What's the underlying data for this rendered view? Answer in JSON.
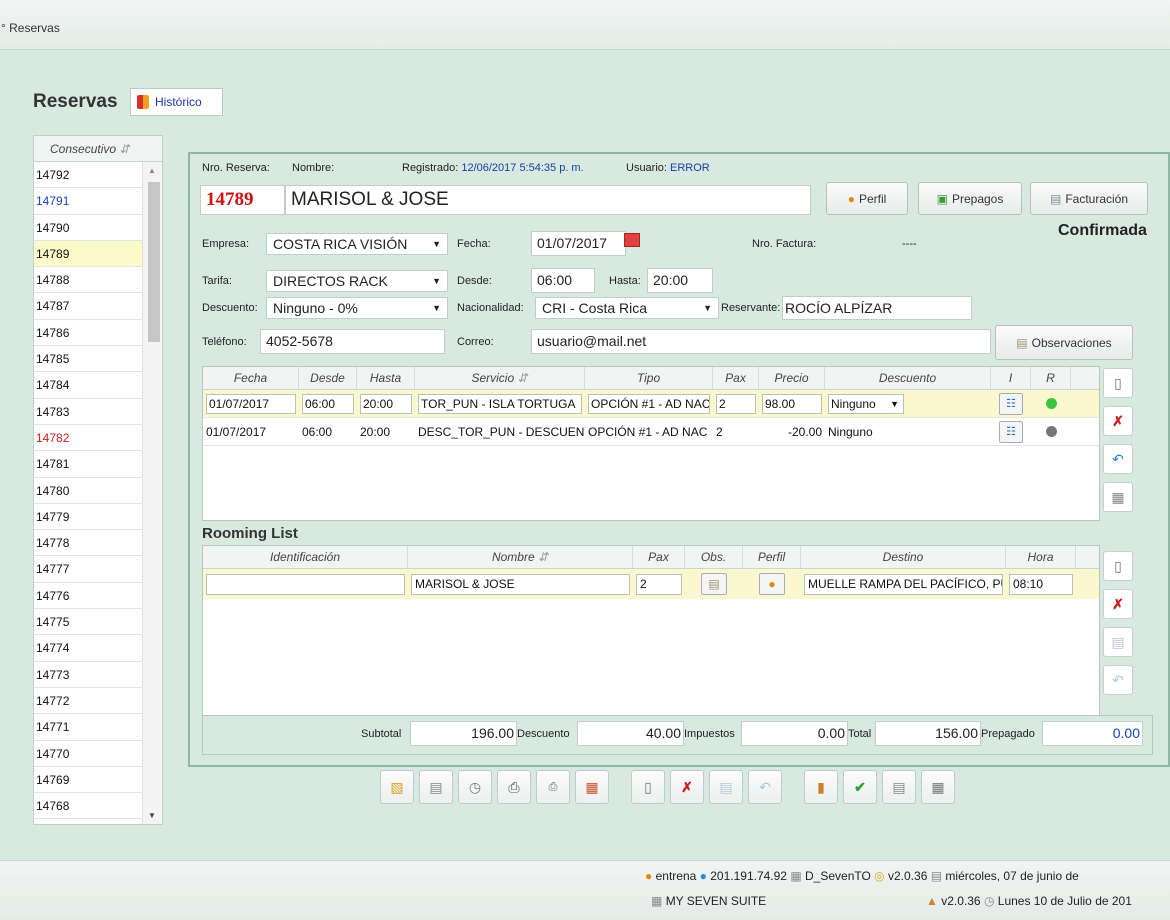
{
  "breadcrumb": "Reservas",
  "page_title": "Reservas",
  "historico_label": "Histórico",
  "list": {
    "header": "Consecutivo",
    "sort_icon": "sort-icon",
    "items": [
      {
        "v": "14792",
        "c": "#111"
      },
      {
        "v": "14791",
        "c": "#1a3fbf"
      },
      {
        "v": "14790",
        "c": "#111"
      },
      {
        "v": "14789",
        "c": "#111",
        "sel": true
      },
      {
        "v": "14788",
        "c": "#111"
      },
      {
        "v": "14787",
        "c": "#111"
      },
      {
        "v": "14786",
        "c": "#111"
      },
      {
        "v": "14785",
        "c": "#111"
      },
      {
        "v": "14784",
        "c": "#111"
      },
      {
        "v": "14783",
        "c": "#111"
      },
      {
        "v": "14782",
        "c": "#cc2020"
      },
      {
        "v": "14781",
        "c": "#111"
      },
      {
        "v": "14780",
        "c": "#111"
      },
      {
        "v": "14779",
        "c": "#111"
      },
      {
        "v": "14778",
        "c": "#111"
      },
      {
        "v": "14777",
        "c": "#111"
      },
      {
        "v": "14776",
        "c": "#111"
      },
      {
        "v": "14775",
        "c": "#111"
      },
      {
        "v": "14774",
        "c": "#111"
      },
      {
        "v": "14773",
        "c": "#111"
      },
      {
        "v": "14772",
        "c": "#111"
      },
      {
        "v": "14771",
        "c": "#111"
      },
      {
        "v": "14770",
        "c": "#111"
      },
      {
        "v": "14769",
        "c": "#111"
      },
      {
        "v": "14768",
        "c": "#111"
      }
    ]
  },
  "reserva": {
    "nro_label": "Nro. Reserva:",
    "nombre_label": "Nombre:",
    "registrado_label": "Registrado:",
    "registrado_value": "12/06/2017 5:54:35 p. m.",
    "usuario_label": "Usuario:",
    "usuario_value": "ERROR",
    "nro": "14789",
    "nombre": "MARISOL & JOSE",
    "perfil": "Perfil",
    "prepagos": "Prepagos",
    "facturacion": "Facturación",
    "estado": "Confirmada",
    "empresa_label": "Empresa:",
    "empresa": "COSTA RICA VISIÓN",
    "fecha_label": "Fecha:",
    "fecha": "01/07/2017",
    "nro_factura_label": "Nro. Factura:",
    "nro_factura": "----",
    "tarifa_label": "Tarifa:",
    "tarifa": "DIRECTOS RACK",
    "desde_label": "Desde:",
    "desde": "06:00",
    "hasta_label": "Hasta:",
    "hasta": "20:00",
    "descuento_label": "Descuento:",
    "descuento": "Ninguno - 0%",
    "nacionalidad_label": "Nacionalidad:",
    "nacionalidad": "CRI - Costa Rica",
    "reservante_label": "Reservante:",
    "reservante": "ROCÍO ALPÍZAR",
    "telefono_label": "Teléfono:",
    "telefono": "4052-5678",
    "correo_label": "Correo:",
    "correo": "usuario@mail.net",
    "observaciones": "Observaciones"
  },
  "services": {
    "headers": [
      "Fecha",
      "Desde",
      "Hasta",
      "Servicio",
      "Tipo",
      "Pax",
      "Precio",
      "Descuento",
      "I",
      "R"
    ],
    "rows": [
      {
        "fecha": "01/07/2017",
        "desde": "06:00",
        "hasta": "20:00",
        "servicio": "TOR_PUN - ISLA TORTUGA",
        "tipo": "OPCIÓN #1 - AD NAC",
        "pax": "2",
        "precio": "98.00",
        "descuento": "Ninguno",
        "status": "#3cc53c"
      },
      {
        "fecha": "01/07/2017",
        "desde": "06:00",
        "hasta": "20:00",
        "servicio": "DESC_TOR_PUN - DESCUENTO",
        "tipo": "OPCIÓN #1 - AD NAC",
        "pax": "2",
        "precio": "-20.00",
        "descuento": "Ninguno",
        "status": "#777777"
      }
    ]
  },
  "rooming": {
    "title": "Rooming List",
    "headers": [
      "Identificación",
      "Nombre",
      "Pax",
      "Obs.",
      "Perfil",
      "Destino",
      "Hora"
    ],
    "rows": [
      {
        "id": "",
        "nombre": "MARISOL & JOSE",
        "pax": "2",
        "destino": "MUELLE RAMPA DEL PACÍFICO, PUNTARENAS",
        "hora": "08:10"
      }
    ]
  },
  "totals": {
    "subtotal_label": "Subtotal",
    "subtotal": "196.00",
    "descuento_label": "Descuento",
    "descuento": "40.00",
    "impuestos_label": "Impuestos",
    "impuestos": "0.00",
    "total_label": "Total",
    "total": "156.00",
    "prepagado_label": "Prepagado",
    "prepagado": "0.00"
  },
  "status": {
    "user": "entrena",
    "ip": "201.191.74.92",
    "db": "D_SevenTO",
    "version": "v2.0.36",
    "date": "miércoles, 07 de junio de",
    "suite": "MY SEVEN SUITE",
    "version2": "v2.0.36",
    "date2": "Lunes 10 de Julio de 201"
  }
}
